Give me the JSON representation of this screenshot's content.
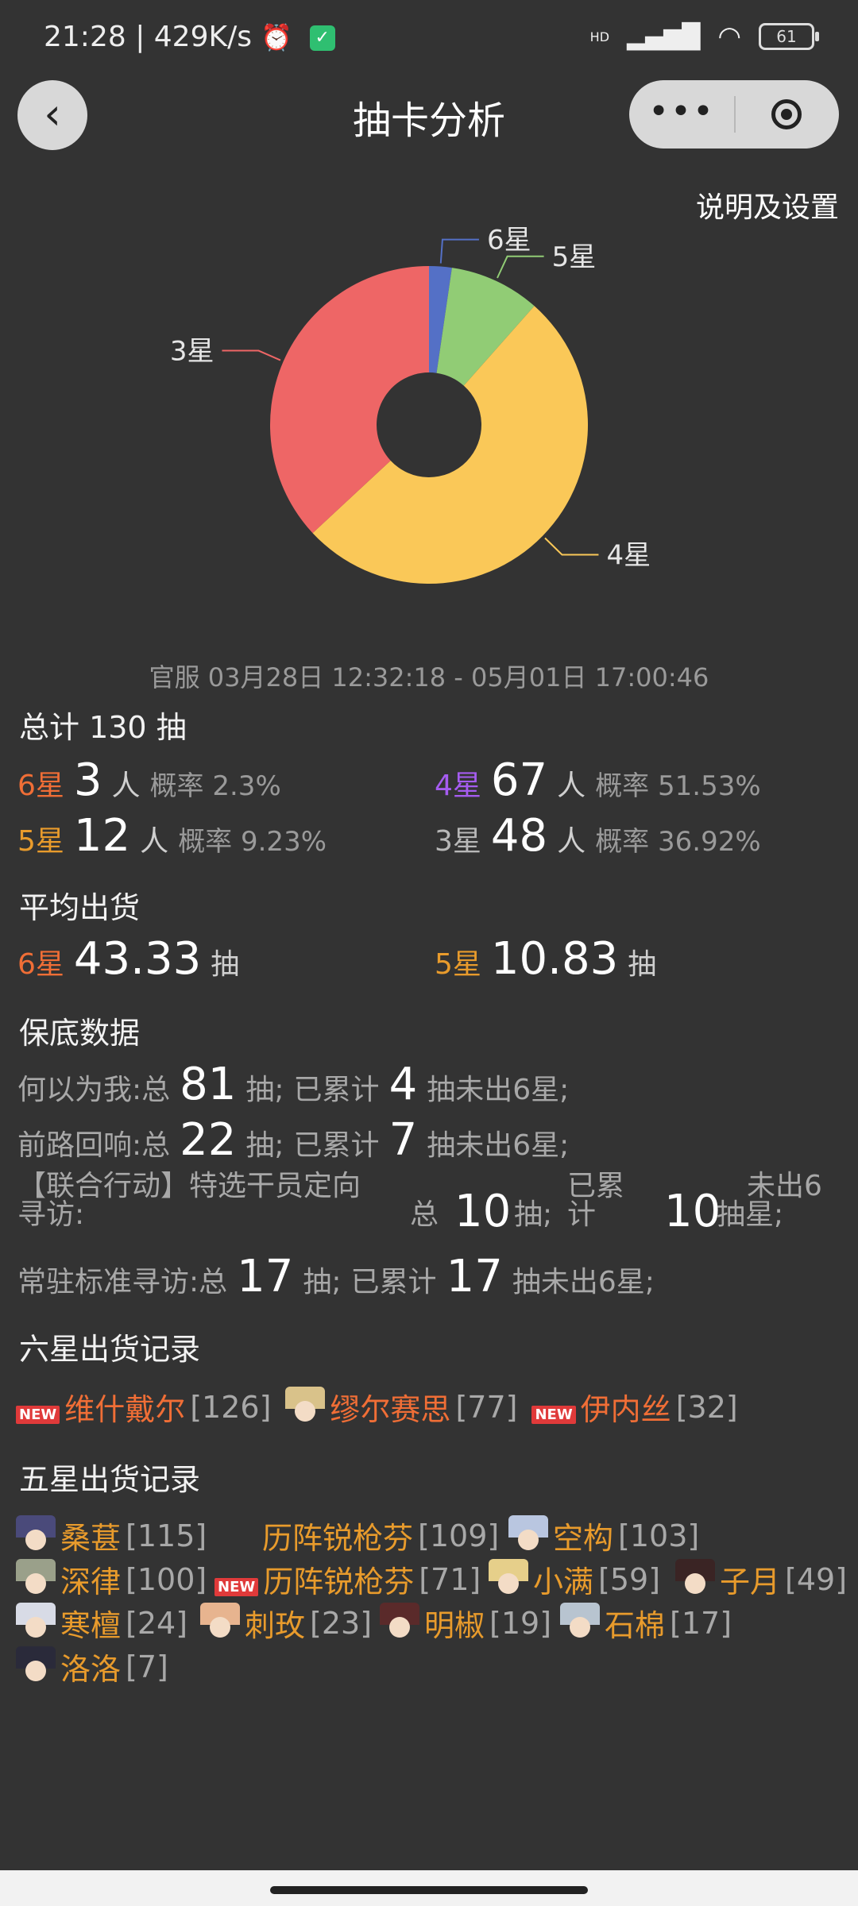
{
  "status": {
    "time_speed": "21:28 | 429K/s",
    "network": "HD",
    "battery": "61"
  },
  "nav": {
    "title": "抽卡分析",
    "back_glyph": "‹",
    "more_glyph": "•••"
  },
  "settings_label": "说明及设置",
  "chart_data": {
    "type": "pie",
    "donut": true,
    "categories": [
      "6星",
      "5星",
      "4星",
      "3星"
    ],
    "values": [
      3,
      12,
      67,
      48
    ],
    "colors": [
      "#5470c6",
      "#91cc75",
      "#fac858",
      "#ee6666"
    ]
  },
  "daterange": "官服  03月28日 12:32:18  -  05月01日 17:00:46",
  "total": {
    "label": "总计 130 抽"
  },
  "stars": {
    "six": {
      "label": "6星",
      "count": "3",
      "unit": "人",
      "rate": "概率 2.3%"
    },
    "four": {
      "label": "4星",
      "count": "67",
      "unit": "人",
      "rate": "概率 51.53%"
    },
    "five": {
      "label": "5星",
      "count": "12",
      "unit": "人",
      "rate": "概率 9.23%"
    },
    "three": {
      "label": "3星",
      "count": "48",
      "unit": "人",
      "rate": "概率 36.92%"
    }
  },
  "average": {
    "title": "平均出货",
    "six": {
      "label": "6星",
      "value": "43.33",
      "unit": "抽"
    },
    "five": {
      "label": "5星",
      "value": "10.83",
      "unit": "抽"
    }
  },
  "guarantee": {
    "title": "保底数据",
    "rows": [
      {
        "pool": "何以为我:总",
        "total": "81",
        "t_unit": "抽;",
        "acc": "已累计",
        "count": "4",
        "c_unit": "抽未出6星;"
      },
      {
        "pool": "前路回响:总",
        "total": "22",
        "t_unit": "抽;",
        "acc": "已累计",
        "count": "7",
        "c_unit": "抽未出6星;"
      },
      {
        "pool_l1": "【联合行动】特选干员定向",
        "pool_l2": "寻访:",
        "pool_tail": "总",
        "total": "10",
        "t_unit": "抽;",
        "acc_l1": "已累",
        "acc_l2": "计",
        "count": "10",
        "c_unit": "抽星;",
        "c_top": "未出6"
      },
      {
        "pool": "常驻标准寻访:总",
        "total": "17",
        "t_unit": "抽;",
        "acc": "已累计",
        "count": "17",
        "c_unit": "抽未出6星;"
      }
    ]
  },
  "six_records": {
    "title": "六星出货记录",
    "new_tag": "NEW",
    "items": [
      {
        "name": "维什戴尔",
        "count": "[126]"
      },
      {
        "name": "缪尔赛思",
        "count": "[77]"
      },
      {
        "name": "伊内丝",
        "count": "[32]"
      }
    ]
  },
  "five_records": {
    "title": "五星出货记录",
    "items": [
      {
        "name": "桑葚",
        "count": "[115]"
      },
      {
        "name": "历阵锐枪芬",
        "count": "[109]"
      },
      {
        "name": "空构",
        "count": "[103]"
      },
      {
        "name": "深律",
        "count": "[100]"
      },
      {
        "name": "历阵锐枪芬",
        "count": "[71]"
      },
      {
        "name": "小满",
        "count": "[59]"
      },
      {
        "name": "子月",
        "count": "[49]"
      },
      {
        "name": "寒檀",
        "count": "[24]"
      },
      {
        "name": "刺玫",
        "count": "[23]"
      },
      {
        "name": "明椒",
        "count": "[19]"
      },
      {
        "name": "石棉",
        "count": "[17]"
      },
      {
        "name": "洛洛",
        "count": "[7]"
      }
    ]
  }
}
